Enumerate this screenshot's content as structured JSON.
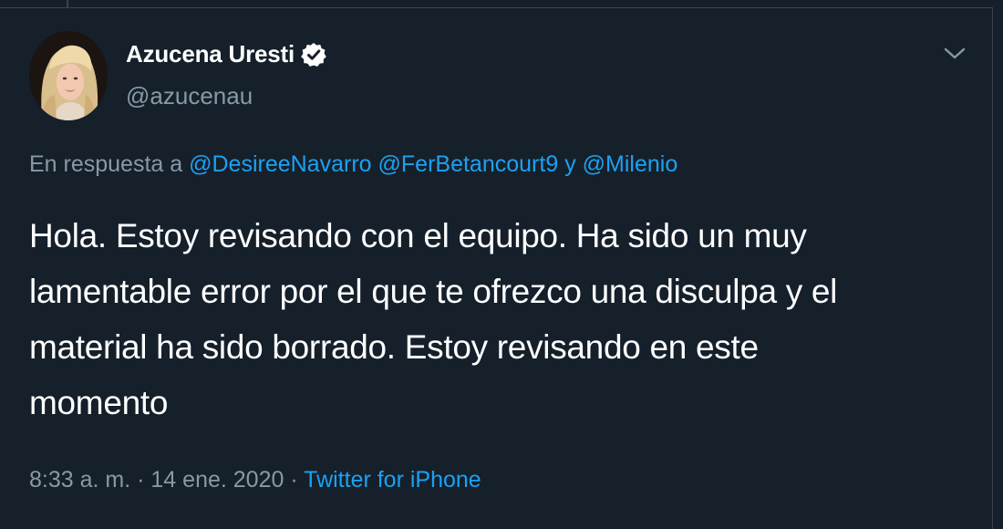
{
  "author": {
    "name": "Azucena Uresti",
    "handle": "@azucenau",
    "verified": true
  },
  "reply": {
    "prefix": "En respuesta a",
    "mentions": [
      "@DesireeNavarro",
      "@FerBetancourt9",
      "@Milenio"
    ],
    "conjunction": "y"
  },
  "body": {
    "lines": [
      "Hola. Estoy revisando con el equipo. Ha sido un muy",
      "lamentable error por el que te ofrezco una disculpa y el",
      "material ha sido borrado. Estoy revisando en este",
      "momento"
    ]
  },
  "meta": {
    "time": "8:33 a. m.",
    "separator": "·",
    "date": "14 ene. 2020",
    "source": "Twitter for iPhone"
  },
  "colors": {
    "background": "#15202b",
    "text": "#ffffff",
    "muted": "#8899a6",
    "accent": "#1da1f2",
    "border": "#38444d"
  },
  "icons": {
    "verified": "verified-badge-icon",
    "menu": "chevron-down-icon"
  }
}
